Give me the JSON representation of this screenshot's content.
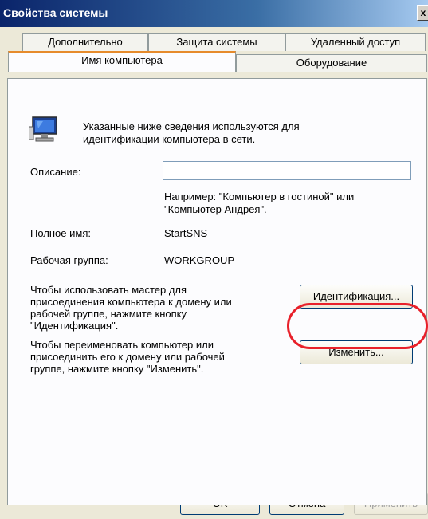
{
  "window": {
    "title": "Свойства системы",
    "close_glyph": "x"
  },
  "tabs": {
    "row1": [
      "Дополнительно",
      "Защита системы",
      "Удаленный доступ"
    ],
    "row2": [
      "Имя компьютера",
      "Оборудование"
    ],
    "active": "Имя компьютера"
  },
  "panel": {
    "intro": [
      "Указанные ниже сведения используются для",
      "идентификации компьютера в сети."
    ],
    "description_label": "Описание:",
    "description_value": "",
    "example": [
      "Например: \"Компьютер в гостиной\" или",
      "\"Компьютер Андрея\"."
    ],
    "full_name_label": "Полное имя:",
    "full_name_value": "StartSNS",
    "workgroup_label": "Рабочая группа:",
    "workgroup_value": "WORKGROUP",
    "wizard_text": [
      "Чтобы использовать мастер для",
      "присоединения компьютера к домену или",
      "рабочей группе, нажмите кнопку",
      "\"Идентификация\"."
    ],
    "identify_button": "Идентификация...",
    "rename_text": [
      "Чтобы переименовать компьютер или",
      "присоединить его к домену или рабочей",
      "группе, нажмите кнопку \"Изменить\"."
    ],
    "change_button": "Изменить..."
  },
  "footer": {
    "ok": "OK",
    "cancel": "Отмена",
    "apply": "Применить"
  },
  "colors": {
    "highlight": "#e8202a",
    "active_tab_accent": "#e68b2c"
  },
  "icons": {
    "computer": "computer-icon"
  }
}
